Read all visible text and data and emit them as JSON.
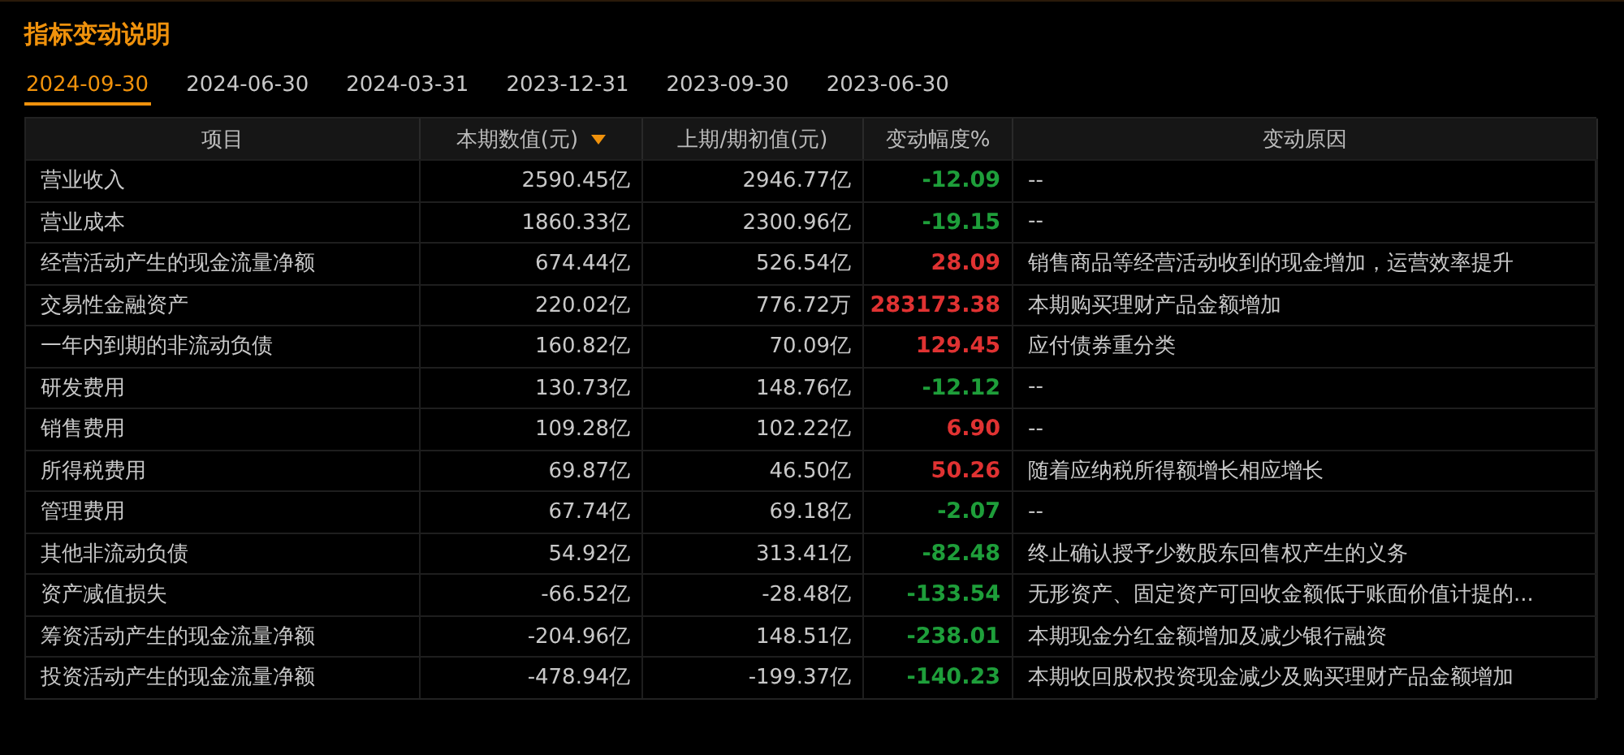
{
  "title": "指标变动说明",
  "tabs": [
    {
      "label": "2024-09-30",
      "selected": true
    },
    {
      "label": "2024-06-30",
      "selected": false
    },
    {
      "label": "2024-03-31",
      "selected": false
    },
    {
      "label": "2023-12-31",
      "selected": false
    },
    {
      "label": "2023-09-30",
      "selected": false
    },
    {
      "label": "2023-06-30",
      "selected": false
    }
  ],
  "table": {
    "columns": [
      {
        "label": "项目",
        "sorted": false
      },
      {
        "label": "本期数值(元)",
        "sorted": true
      },
      {
        "label": "上期/期初值(元)",
        "sorted": false
      },
      {
        "label": "变动幅度%",
        "sorted": false
      },
      {
        "label": "变动原因",
        "sorted": false
      }
    ],
    "rows": [
      {
        "item": "营业收入",
        "current": "2590.45亿",
        "previous": "2946.77亿",
        "change": "-12.09",
        "color": "#1e9e3a",
        "reason": "--"
      },
      {
        "item": "营业成本",
        "current": "1860.33亿",
        "previous": "2300.96亿",
        "change": "-19.15",
        "color": "#1e9e3a",
        "reason": "--"
      },
      {
        "item": "经营活动产生的现金流量净额",
        "current": "674.44亿",
        "previous": "526.54亿",
        "change": "28.09",
        "color": "#e03232",
        "reason": "销售商品等经营活动收到的现金增加，运营效率提升"
      },
      {
        "item": "交易性金融资产",
        "current": "220.02亿",
        "previous": "776.72万",
        "change": "283173.38",
        "color": "#e03232",
        "reason": "本期购买理财产品金额增加"
      },
      {
        "item": "一年内到期的非流动负债",
        "current": "160.82亿",
        "previous": "70.09亿",
        "change": "129.45",
        "color": "#e03232",
        "reason": "应付债券重分类"
      },
      {
        "item": "研发费用",
        "current": "130.73亿",
        "previous": "148.76亿",
        "change": "-12.12",
        "color": "#1e9e3a",
        "reason": "--"
      },
      {
        "item": "销售费用",
        "current": "109.28亿",
        "previous": "102.22亿",
        "change": "6.90",
        "color": "#e03232",
        "reason": "--"
      },
      {
        "item": "所得税费用",
        "current": "69.87亿",
        "previous": "46.50亿",
        "change": "50.26",
        "color": "#e03232",
        "reason": "随着应纳税所得额增长相应增长"
      },
      {
        "item": "管理费用",
        "current": "67.74亿",
        "previous": "69.18亿",
        "change": "-2.07",
        "color": "#1e9e3a",
        "reason": "--"
      },
      {
        "item": "其他非流动负债",
        "current": "54.92亿",
        "previous": "313.41亿",
        "change": "-82.48",
        "color": "#1e9e3a",
        "reason": "终止确认授予少数股东回售权产生的义务"
      },
      {
        "item": "资产减值损失",
        "current": "-66.52亿",
        "previous": "-28.48亿",
        "change": "-133.54",
        "color": "#1e9e3a",
        "reason": "无形资产、固定资产可回收金额低于账面价值计提的..."
      },
      {
        "item": "筹资活动产生的现金流量净额",
        "current": "-204.96亿",
        "previous": "148.51亿",
        "change": "-238.01",
        "color": "#1e9e3a",
        "reason": "本期现金分红金额增加及减少银行融资"
      },
      {
        "item": "投资活动产生的现金流量净额",
        "current": "-478.94亿",
        "previous": "-199.37亿",
        "change": "-140.23",
        "color": "#1e9e3a",
        "reason": "本期收回股权投资现金减少及购买理财产品金额增加"
      }
    ]
  }
}
